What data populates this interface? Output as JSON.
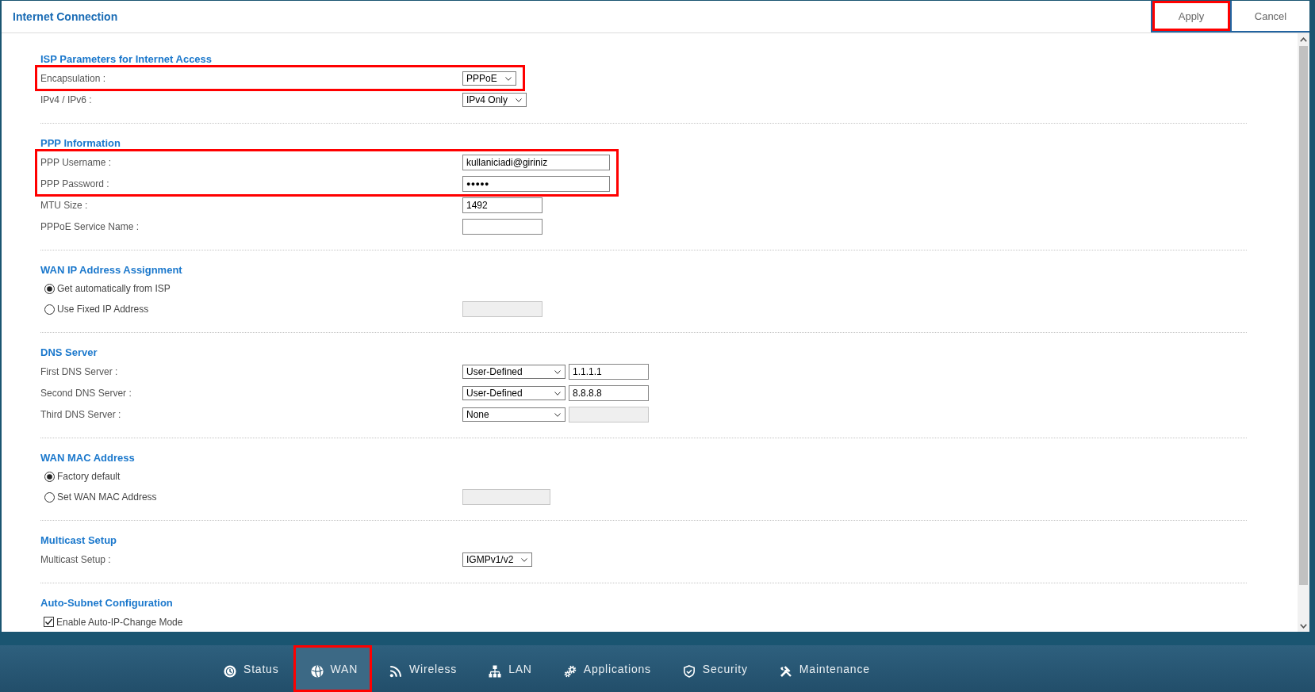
{
  "header": {
    "title": "Internet Connection",
    "buttons": [
      {
        "label": "Apply",
        "highlighted": true
      },
      {
        "label": "Cancel",
        "highlighted": false
      }
    ]
  },
  "sections": [
    {
      "title": "ISP Parameters for Internet Access",
      "rows": [
        {
          "kind": "select",
          "label": "Encapsulation :",
          "value": "PPPoE",
          "highlighted": true
        },
        {
          "kind": "select",
          "label": "IPv4 / IPv6 :",
          "value": "IPv4 Only",
          "highlighted": false
        }
      ]
    },
    {
      "title": "PPP Information",
      "rows": [
        {
          "kind": "text",
          "label": "PPP Username :",
          "value": "kullaniciadi@giriniz",
          "highlighted": true
        },
        {
          "kind": "password",
          "label": "PPP Password :",
          "value": "●●●●●",
          "highlighted": true
        },
        {
          "kind": "text",
          "label": "MTU Size :",
          "value": "1492",
          "highlighted": false
        },
        {
          "kind": "text",
          "label": "PPPoE Service Name :",
          "highlighted": false
        }
      ]
    },
    {
      "title": "WAN IP Address Assignment",
      "rows": [
        {
          "kind": "radio",
          "label": "Get automatically from ISP",
          "selected": true,
          "highlighted": false
        },
        {
          "kind": "radio",
          "label": "Use Fixed IP Address",
          "selected": false,
          "highlighted": false,
          "field": {
            "disabled": true
          }
        }
      ]
    },
    {
      "title": "DNS Server",
      "rows": [
        {
          "kind": "combo",
          "label": "First DNS Server :",
          "value": "User-Defined",
          "highlighted": false,
          "field": {
            "value": "1.1.1.1",
            "disabled": false
          }
        },
        {
          "kind": "combo",
          "label": "Second DNS Server :",
          "value": "User-Defined",
          "highlighted": false,
          "field": {
            "value": "8.8.8.8",
            "disabled": false
          }
        },
        {
          "kind": "combo",
          "label": "Third DNS Server :",
          "value": "None",
          "highlighted": false,
          "field": {
            "disabled": true
          }
        }
      ]
    },
    {
      "title": "WAN MAC Address",
      "rows": [
        {
          "kind": "radio",
          "label": "Factory default",
          "selected": true,
          "highlighted": false
        },
        {
          "kind": "radio",
          "label": "Set WAN MAC Address",
          "selected": false,
          "highlighted": false,
          "field": {
            "disabled": true
          }
        }
      ]
    },
    {
      "title": "Multicast Setup",
      "rows": [
        {
          "kind": "select",
          "label": "Multicast Setup :",
          "value": "IGMPv1/v2",
          "highlighted": false
        }
      ]
    },
    {
      "title": "Auto-Subnet Configuration",
      "rows": [
        {
          "kind": "checkbox",
          "label": "Enable Auto-IP-Change Mode",
          "checked": true,
          "highlighted": false
        }
      ]
    }
  ],
  "nav": {
    "items": [
      {
        "label": "Status",
        "selected": false,
        "highlighted": false
      },
      {
        "label": "WAN",
        "selected": true,
        "highlighted": true
      },
      {
        "label": "Wireless",
        "selected": false,
        "highlighted": false
      },
      {
        "label": "LAN",
        "selected": false,
        "highlighted": false
      },
      {
        "label": "Applications",
        "selected": false,
        "highlighted": false
      },
      {
        "label": "Security",
        "selected": false,
        "highlighted": false
      },
      {
        "label": "Maintenance",
        "selected": false,
        "highlighted": false
      }
    ]
  }
}
